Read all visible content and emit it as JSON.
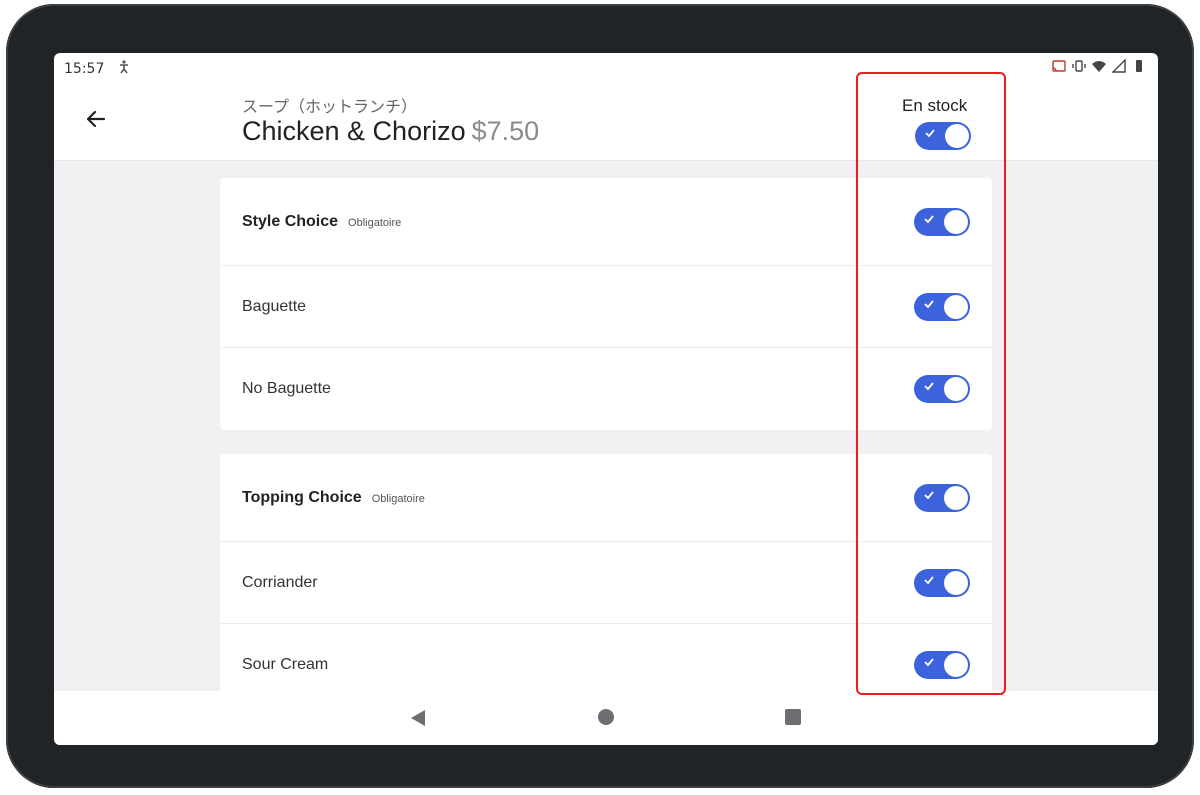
{
  "status_bar": {
    "time": "15:57",
    "icons": [
      "accessibility-icon",
      "cast-icon",
      "vibrate-icon",
      "wifi-icon",
      "signal-icon",
      "battery-icon"
    ]
  },
  "header": {
    "subtitle": "スープ（ホットランチ）",
    "title": "Chicken & Chorizo",
    "price": "$7.50",
    "stock_label": "En stock",
    "stock_on": true
  },
  "groups": [
    {
      "name": "Style Choice",
      "required_label": "Obligatoire",
      "enabled": true,
      "options": [
        {
          "label": "Baguette",
          "enabled": true
        },
        {
          "label": "No Baguette",
          "enabled": true
        }
      ]
    },
    {
      "name": "Topping Choice",
      "required_label": "Obligatoire",
      "enabled": true,
      "options": [
        {
          "label": "Corriander",
          "enabled": true
        },
        {
          "label": "Sour Cream",
          "enabled": true
        }
      ]
    }
  ],
  "colors": {
    "toggle_on": "#3c63dc",
    "highlight": "#ee1c1c",
    "background": "#f1f1f4"
  }
}
